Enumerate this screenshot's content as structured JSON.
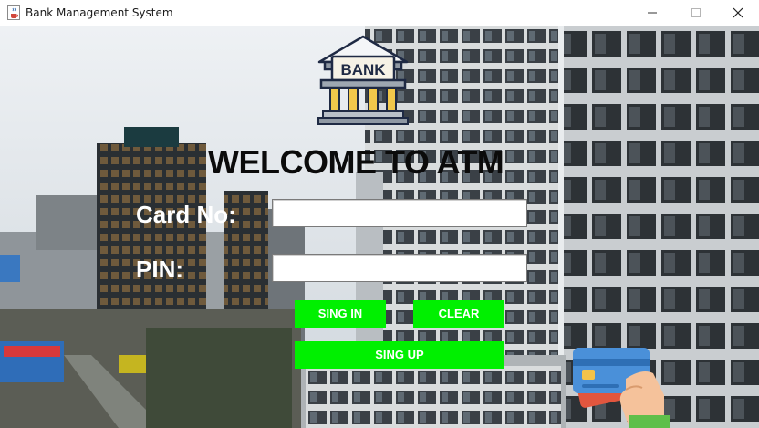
{
  "window": {
    "title": "Bank Management System",
    "icon": "java-coffee-icon",
    "controls": [
      "minimize-icon",
      "maximize-icon",
      "close-icon"
    ]
  },
  "logo": {
    "text": "BANK",
    "icon": "bank-building-icon"
  },
  "heading": "WELCOME TO ATM",
  "form": {
    "card_label": "Card No:",
    "card_value": "",
    "pin_label": "PIN:",
    "pin_value": ""
  },
  "buttons": {
    "sign_in": "SING IN",
    "clear": "CLEAR",
    "sign_up": "SING UP"
  },
  "decor": {
    "card_icon": "credit-card-hand-icon",
    "background": "city-skyscrapers-photo"
  },
  "colors": {
    "button_bg": "#00f000",
    "button_text": "#ffffff",
    "heading_text": "#0b0b0b",
    "label_text": "#ffffff"
  }
}
